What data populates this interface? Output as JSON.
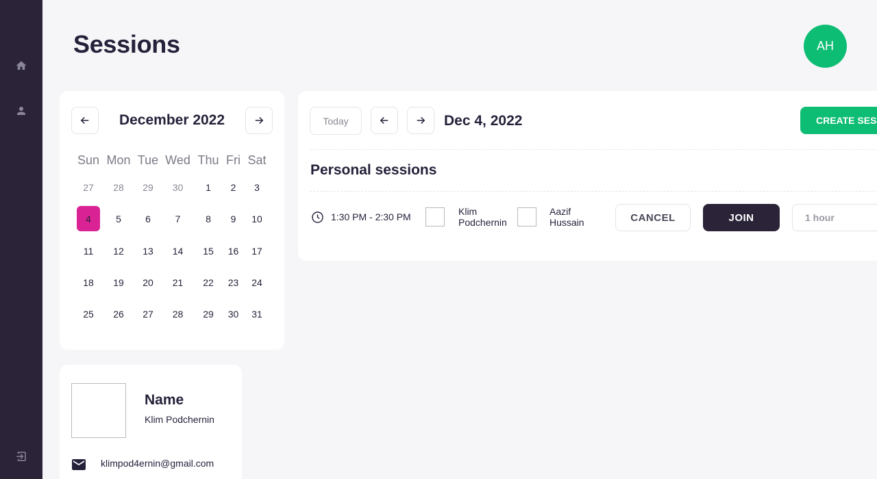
{
  "app": {
    "title": "Sessions",
    "user_initials": "AH"
  },
  "sidebar": {
    "items": [
      {
        "name": "home",
        "icon": "home-icon"
      },
      {
        "name": "profile",
        "icon": "person-icon"
      },
      {
        "name": "logout",
        "icon": "logout-icon"
      }
    ]
  },
  "calendar": {
    "month_label": "December 2022",
    "weekdays": [
      "Sun",
      "Mon",
      "Tue",
      "Wed",
      "Thu",
      "Fri",
      "Sat"
    ],
    "weeks": [
      [
        "27",
        "28",
        "29",
        "30",
        "1",
        "2",
        "3"
      ],
      [
        "4",
        "5",
        "6",
        "7",
        "8",
        "9",
        "10"
      ],
      [
        "11",
        "12",
        "13",
        "14",
        "15",
        "16",
        "17"
      ],
      [
        "18",
        "19",
        "20",
        "21",
        "22",
        "23",
        "24"
      ],
      [
        "25",
        "26",
        "27",
        "28",
        "29",
        "30",
        "31"
      ]
    ],
    "selected_day": "4",
    "accent_color": "#d92394"
  },
  "sessions": {
    "today_label": "Today",
    "date_label": "Dec 4, 2022",
    "create_label": "CREATE SESSION",
    "section_title": "Personal sessions",
    "items": [
      {
        "time": "1:30 PM - 2:30 PM",
        "host": "Klim Podchernin",
        "guest": "Aazif Hussain",
        "cancel_label": "CANCEL",
        "join_label": "JOIN",
        "duration": "1 hour"
      }
    ]
  },
  "profile": {
    "label": "Name",
    "name": "Klim Podchernin",
    "email": "klimpod4ernin@gmail.com"
  },
  "colors": {
    "sidebar": "#2b2438",
    "brand_green": "#0ebd74",
    "dark_button": "#2b2438"
  }
}
